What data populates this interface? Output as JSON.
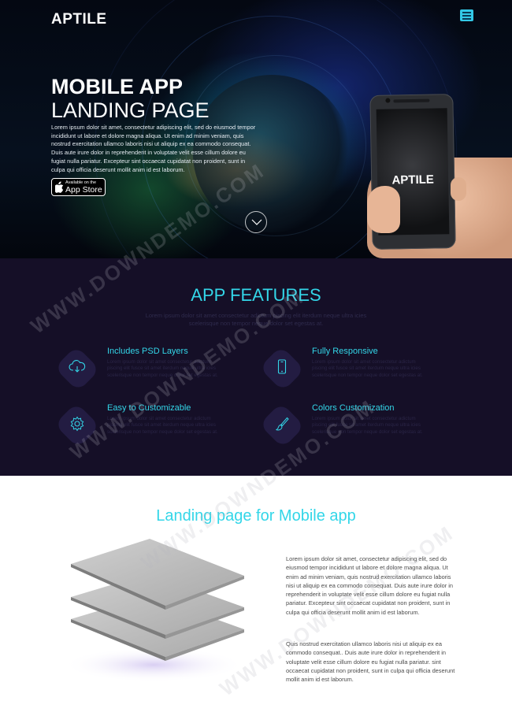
{
  "header": {
    "logo": "APTILE",
    "menu_icon": "hamburger-icon"
  },
  "hero": {
    "title_line1": "MOBILE APP",
    "title_line2": "LANDING PAGE",
    "text": "Lorem ipsum dolor sit amet, consectetur adipiscing elit, sed do eiusmod tempor incididunt ut labore et dolore magna aliqua. Ut enim ad minim veniam, quis nostrud exercitation ullamco laboris nisi ut aliquip ex ea commodo consequat. Duis aute irure dolor in reprehenderit in voluptate velit esse cillum dolore eu fugiat nulla pariatur. Excepteur sint occaecat cupidatat non proident, sunt in culpa qui officia deserunt mollit anim id est laborum.",
    "appstore_small": "Available on the",
    "appstore_big": "App Store",
    "phone_brand": "APTILE",
    "scroll_icon": "chevron-down-icon"
  },
  "features": {
    "title": "APP FEATURES",
    "subtitle": "Lorem ipsum dolor sit amet consectetur adictum piscing elit iterdum neque ultra icies scelerisque non tempor neque dolor set egestas at.",
    "items": [
      {
        "title": "Includes PSD Layers",
        "text": "Lorem ipsum dolor sit amet consectetur adictum piscing elit fusce sit amet iterdum neque ultra icies scelerisque non tempor neque dolor set egestas at.",
        "icon": "cloud-download-icon"
      },
      {
        "title": "Fully Responsive",
        "text": "Lorem ipsum dolor sit amet consectetur adictum piscing elit fusce sit amet iterdum neque ultra icies scelerisque non tempor neque dolor set egestas at.",
        "icon": "mobile-icon"
      },
      {
        "title": "Easy to Customizable",
        "text": "Lorem ipsum dolor sit amet consectetur adictum piscing elit fusce sit amet iterdum neque ultra icies scelerisque non tempor neque dolor set egestas at.",
        "icon": "gear-icon"
      },
      {
        "title": "Colors Customization",
        "text": "Lorem ipsum dolor sit amet consectetur adictum piscing elit fusce sit amet iterdum neque ultra icies scelerisque non tempor neque dolor set egestas at.",
        "icon": "brush-icon"
      }
    ]
  },
  "landing": {
    "title": "Landing page for Mobile app",
    "para1": "Lorem ipsum dolor sit amet, consectetur adipiscing elit, sed do eiusmod tempor incididunt ut labore et dolore magna aliqua. Ut enim ad minim veniam, quis nostrud exercitation ullamco laboris nisi ut aliquip ex ea commodo consequat. Duis aute irure dolor in reprehenderit in voluptate velit esse cillum dolore eu fugiat nulla pariatur. Excepteur sint occaecat cupidatat non proident, sunt in culpa qui officia deserunt mollit anim id est laborum.",
    "para2": "Quis nostrud exercitation ullamco laboris nisi ut aliquip ex ea commodo consequat.. Duis aute irure dolor in reprehenderit in voluptate velit esse cillum dolore eu fugiat nulla pariatur. sint occaecat cupidatat non proident, sunt in culpa qui officia deserunt mollit anim id est laborum.",
    "image_icon": "stacked-layers-icon"
  },
  "watermark": "WWW.DOWNDEMO.COM",
  "colors": {
    "accent": "#33d6e8",
    "features_bg": "#150f27",
    "hero_bg": "#040812"
  }
}
